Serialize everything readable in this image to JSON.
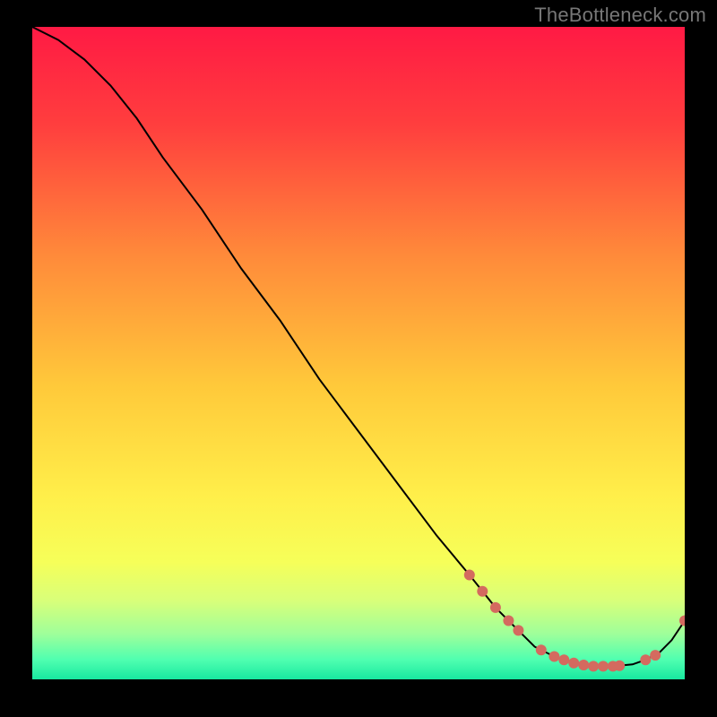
{
  "watermark": "TheBottleneck.com",
  "chart_data": {
    "type": "line",
    "title": "",
    "xlabel": "",
    "ylabel": "",
    "xlim": [
      0,
      100
    ],
    "ylim": [
      0,
      100
    ],
    "background_gradient": {
      "stops": [
        {
          "pos": 0.0,
          "color": "#ff1a44"
        },
        {
          "pos": 0.15,
          "color": "#ff3e3e"
        },
        {
          "pos": 0.35,
          "color": "#ff8a3a"
        },
        {
          "pos": 0.55,
          "color": "#ffc93a"
        },
        {
          "pos": 0.72,
          "color": "#ffef4a"
        },
        {
          "pos": 0.82,
          "color": "#f6ff59"
        },
        {
          "pos": 0.88,
          "color": "#d8ff7a"
        },
        {
          "pos": 0.93,
          "color": "#9fff9a"
        },
        {
          "pos": 0.97,
          "color": "#4fffb0"
        },
        {
          "pos": 1.0,
          "color": "#18e8a0"
        }
      ]
    },
    "series": [
      {
        "name": "curve",
        "stroke": "#000000",
        "x": [
          0,
          4,
          8,
          12,
          16,
          20,
          26,
          32,
          38,
          44,
          50,
          56,
          62,
          67,
          71,
          74,
          77,
          80,
          83,
          86,
          89,
          92,
          94,
          96,
          98,
          100
        ],
        "y": [
          100,
          98,
          95,
          91,
          86,
          80,
          72,
          63,
          55,
          46,
          38,
          30,
          22,
          16,
          11,
          8,
          5,
          3.5,
          2.5,
          2,
          2,
          2.3,
          3,
          4,
          6,
          9
        ]
      }
    ],
    "markers": {
      "name": "highlight-dots",
      "color": "#d46a5f",
      "radius": 6,
      "points": [
        {
          "x": 67,
          "y": 16
        },
        {
          "x": 69,
          "y": 13.5
        },
        {
          "x": 71,
          "y": 11
        },
        {
          "x": 73,
          "y": 9
        },
        {
          "x": 74.5,
          "y": 7.5
        },
        {
          "x": 78,
          "y": 4.5
        },
        {
          "x": 80,
          "y": 3.5
        },
        {
          "x": 81.5,
          "y": 3
        },
        {
          "x": 83,
          "y": 2.5
        },
        {
          "x": 84.5,
          "y": 2.2
        },
        {
          "x": 86,
          "y": 2
        },
        {
          "x": 87.5,
          "y": 2
        },
        {
          "x": 89,
          "y": 2
        },
        {
          "x": 90,
          "y": 2.1
        },
        {
          "x": 94,
          "y": 3
        },
        {
          "x": 95.5,
          "y": 3.7
        },
        {
          "x": 100,
          "y": 9
        }
      ]
    }
  }
}
